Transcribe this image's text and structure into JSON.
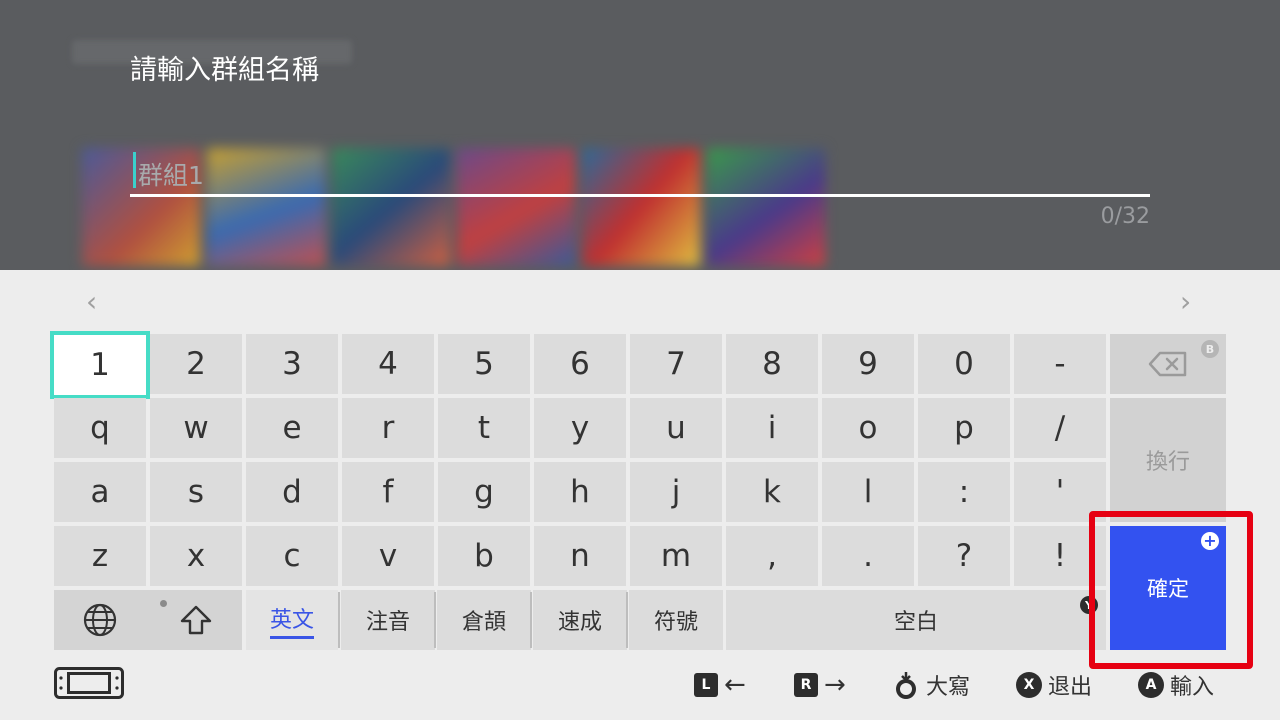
{
  "dialog": {
    "title": "請輸入群組名稱",
    "input_placeholder": "群組1",
    "char_counter": "0/32"
  },
  "nav": {
    "prev_page": "‹",
    "next_page": "›"
  },
  "rows": [
    [
      "1",
      "2",
      "3",
      "4",
      "5",
      "6",
      "7",
      "8",
      "9",
      "0",
      "-"
    ],
    [
      "q",
      "w",
      "e",
      "r",
      "t",
      "y",
      "u",
      "i",
      "o",
      "p",
      "/"
    ],
    [
      "a",
      "s",
      "d",
      "f",
      "g",
      "h",
      "j",
      "k",
      "l",
      ":",
      "'"
    ],
    [
      "z",
      "x",
      "c",
      "v",
      "b",
      "n",
      "m",
      ",",
      ".",
      "?",
      "!"
    ]
  ],
  "side_keys": {
    "backspace_badge": "B",
    "newline": "換行",
    "confirm": "確定",
    "confirm_badge": "+"
  },
  "bottom_row": {
    "globe": "🌐",
    "shift_badge": "•",
    "modes": [
      "英文",
      "注音",
      "倉頡",
      "速成",
      "符號"
    ],
    "active_mode": "英文",
    "space": "空白",
    "space_badge": "Y"
  },
  "hints": {
    "l_button": "L",
    "l_label": "←",
    "r_button": "R",
    "r_label": "→",
    "stick_label": "大寫",
    "x_button": "X",
    "x_label": "退出",
    "a_button": "A",
    "a_label": "輸入"
  },
  "colors": {
    "accent_selection": "#46dcc6",
    "confirm_blue": "#3352f0",
    "highlight_red": "#e60012",
    "active_mode_text": "#3a55e6"
  }
}
